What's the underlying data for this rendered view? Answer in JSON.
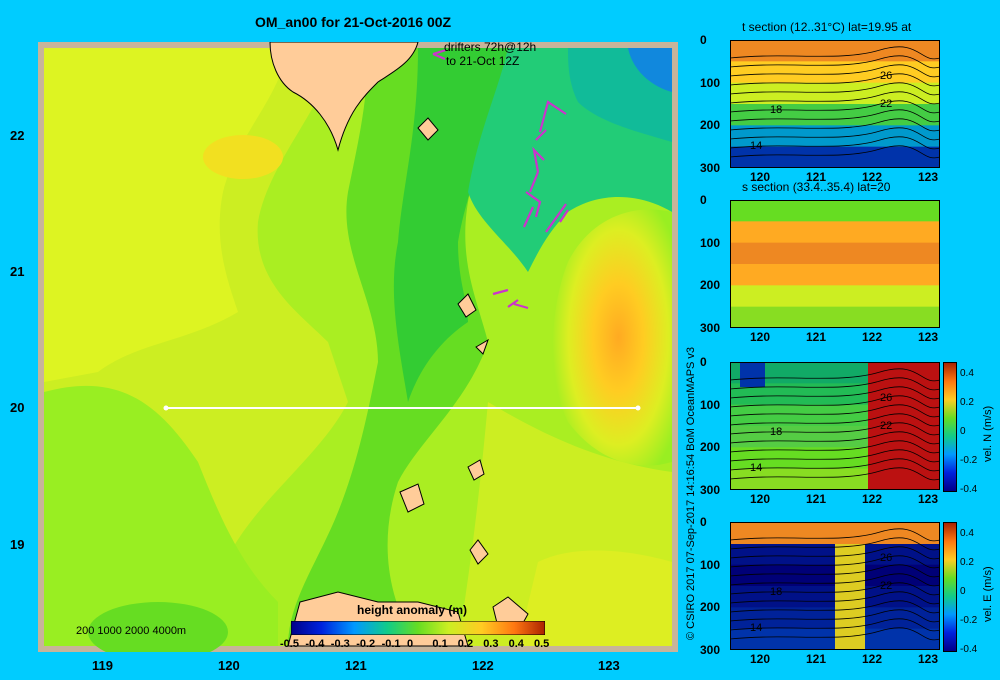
{
  "map": {
    "title": "OM_an00 for 21-Oct-2016 00Z",
    "drifter_note_1": "drifters 72h@12h",
    "drifter_note_2": "to 21-Oct 12Z",
    "x_ticks": [
      "119",
      "120",
      "121",
      "122",
      "123"
    ],
    "y_ticks": [
      "22",
      "21",
      "20",
      "19"
    ],
    "depth_legend": "200  1000  2000  4000m",
    "colorbar_label": "height anomaly (m)",
    "colorbar_ticks": [
      "-0.5",
      "-0.4",
      "-0.3",
      "-0.2",
      "-0.1",
      "0",
      "0.1",
      "0.2",
      "0.3",
      "0.4",
      "0.5"
    ],
    "credit": "© CSIRO 2017   07-Sep-2017 14:16:54 BoM OceanMAPS v3"
  },
  "sections": [
    {
      "title": "t section (12..31°C) lat=19.95 at",
      "y_ticks": [
        "0",
        "100",
        "200",
        "300"
      ],
      "x_ticks": [
        "120",
        "121",
        "122",
        "123"
      ],
      "labels": [
        "26",
        "22",
        "18",
        "14"
      ]
    },
    {
      "title": "s section (33.4..35.4) lat=20",
      "y_ticks": [
        "0",
        "100",
        "200",
        "300"
      ],
      "x_ticks": [
        "120",
        "121",
        "122",
        "123"
      ],
      "labels": []
    },
    {
      "title": "",
      "y_ticks": [
        "0",
        "100",
        "200",
        "300"
      ],
      "x_ticks": [
        "120",
        "121",
        "122",
        "123"
      ],
      "labels": [
        "26",
        "22",
        "18",
        "14"
      ],
      "cbar_label": "vel. N (m/s)",
      "cbar_ticks": [
        "0.4",
        "0.2",
        "0",
        "-0.2",
        "-0.4"
      ]
    },
    {
      "title": "",
      "y_ticks": [
        "0",
        "100",
        "200",
        "300"
      ],
      "x_ticks": [
        "120",
        "121",
        "122",
        "123"
      ],
      "labels": [
        "26",
        "22",
        "18",
        "14"
      ],
      "cbar_label": "vel. E (m/s)",
      "cbar_ticks": [
        "0.4",
        "0.2",
        "0",
        "-0.2",
        "-0.4"
      ]
    }
  ],
  "colors": {
    "background": "#00ccff",
    "land": "#ffcc99",
    "shelf": "#c8b49a",
    "drifter": "#cc33cc",
    "section_line": "#ffffff"
  }
}
